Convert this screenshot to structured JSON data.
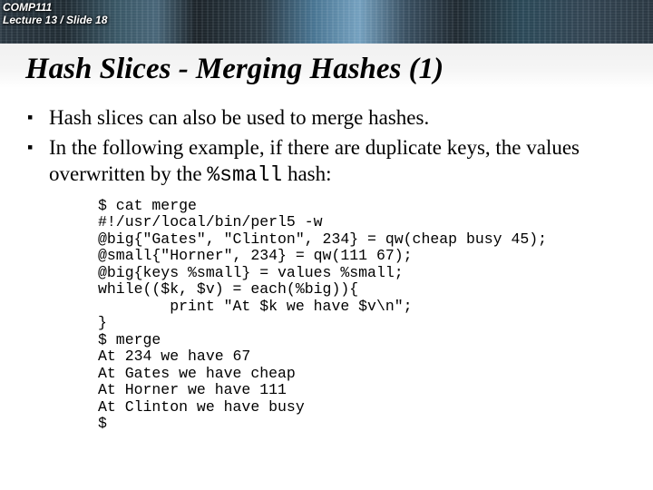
{
  "header": {
    "course": "COMP111",
    "lecture_line": "Lecture 13 / Slide 18"
  },
  "title": "Hash Slices - Merging Hashes (1)",
  "bullets": [
    "Hash slices can also be used to merge hashes.",
    "In the following example, if there are duplicate keys, the values overwritten by the "
  ],
  "bullet2_mono": "%small",
  "bullet2_tail": " hash:",
  "code": "$ cat merge\n#!/usr/local/bin/perl5 -w\n@big{\"Gates\", \"Clinton\", 234} = qw(cheap busy 45);\n@small{\"Horner\", 234} = qw(111 67);\n@big{keys %small} = values %small;\nwhile(($k, $v) = each(%big)){\n        print \"At $k we have $v\\n\";\n}\n$ merge\nAt 234 we have 67\nAt Gates we have cheap\nAt Horner we have 111\nAt Clinton we have busy\n$"
}
